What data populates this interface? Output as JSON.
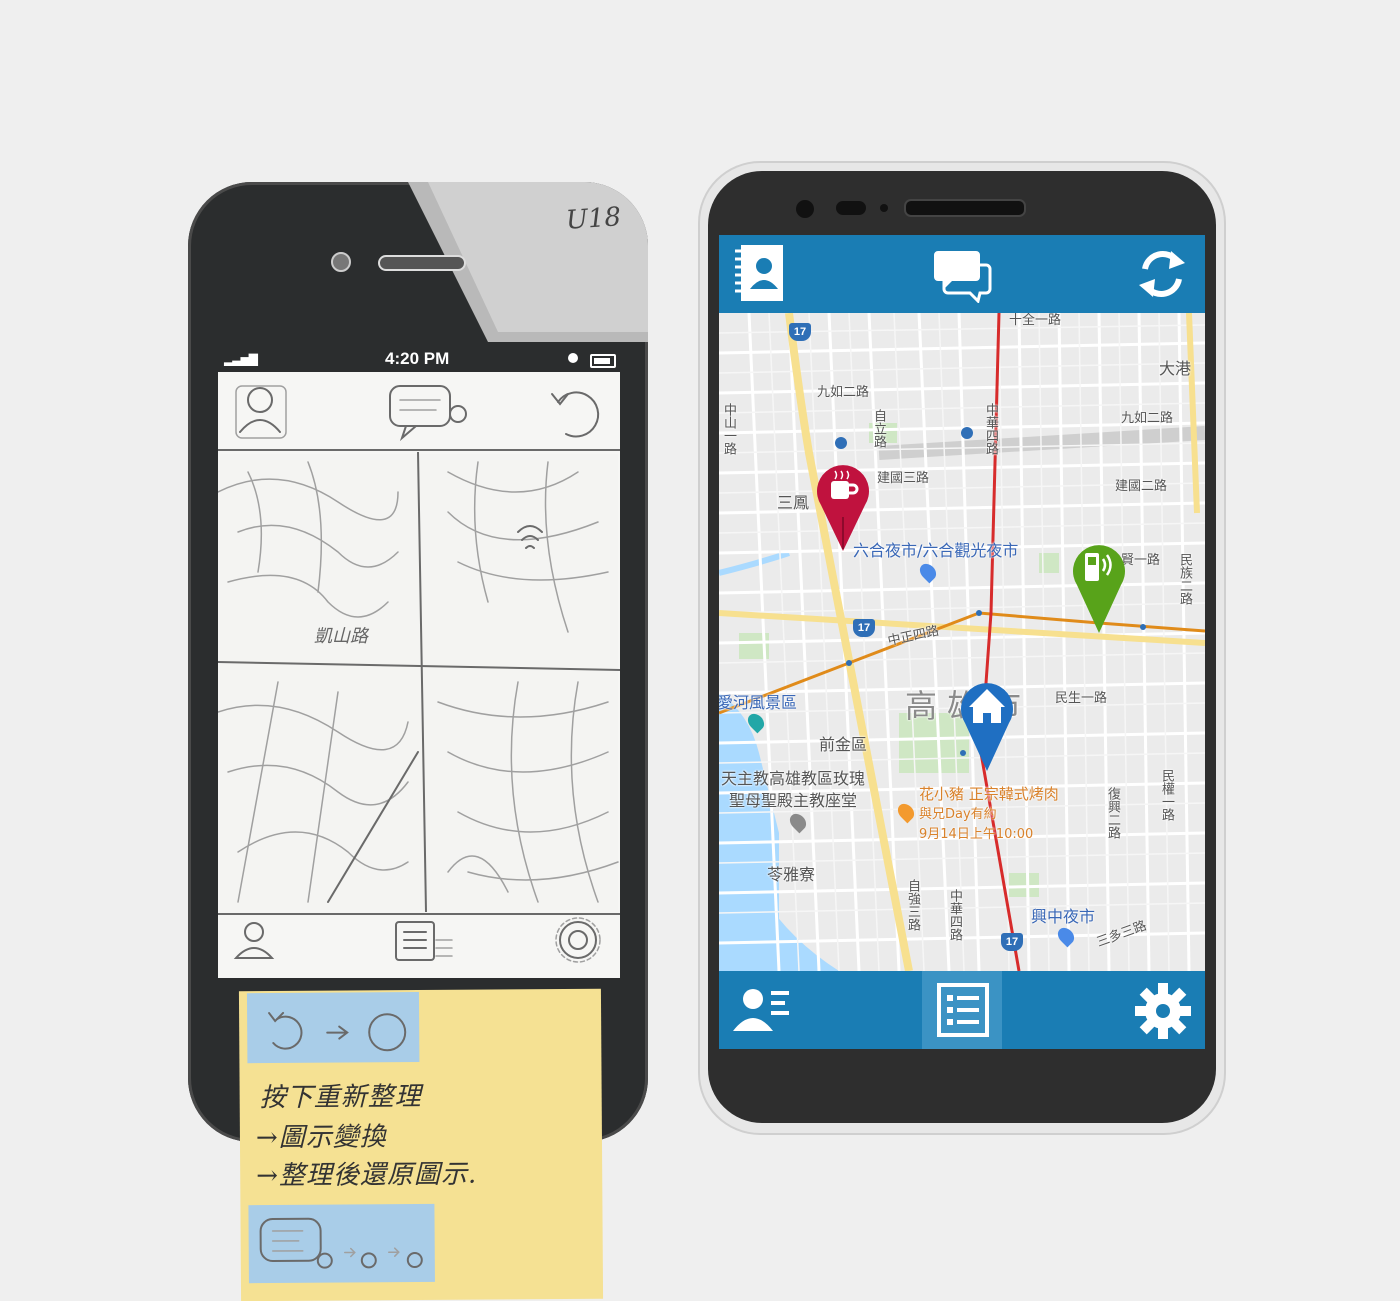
{
  "sketch": {
    "corner_mark": "U18",
    "status_time": "4:20 PM",
    "map_labels": [
      "凱山路"
    ],
    "sticky_note": {
      "lines": [
        "按下重新整理",
        "→圖示變換",
        "→整理後還原圖示."
      ]
    }
  },
  "android": {
    "top_bar": {
      "contacts_icon": "address-book-icon",
      "chat_icon": "chat-bubbles-icon",
      "refresh_icon": "refresh-icon"
    },
    "bottom_bar": {
      "profile_icon": "user-list-icon",
      "list_icon": "list-icon",
      "settings_icon": "gear-icon"
    },
    "map": {
      "city_label": "高雄市",
      "districts": [
        "前金區",
        "苓雅寮"
      ],
      "roads": [
        "九如二路",
        "九如二路",
        "建國二路",
        "建國三路",
        "三鳳",
        "民生一路",
        "中正四路",
        "自立路",
        "中華四路",
        "自強三路",
        "中華四路",
        "三多三路",
        "民族二路",
        "民權一路",
        "復興二路",
        "大港",
        "賢一路",
        "十全一路",
        "中山一路"
      ],
      "road_numbers": [
        "17",
        "17",
        "17"
      ],
      "pois": {
        "night_market_1": "六合夜市/六合觀光夜市",
        "scenic": "愛河風景區",
        "church_line1": "天主教高雄教區玫瑰",
        "church_line2": "聖母聖殿主教座堂",
        "restaurant": "花小豬 正宗韓式烤肉",
        "date_line1": "與兄Day有約",
        "date_line2": "9月14日上午10:00",
        "night_market_2": "興中夜市"
      },
      "pins": [
        {
          "name": "coffee-pin",
          "icon": "coffee-cup-icon",
          "color": "#c0123e"
        },
        {
          "name": "phone-pin",
          "icon": "mobile-phone-icon",
          "color": "#58a31a"
        },
        {
          "name": "home-pin",
          "icon": "home-icon",
          "color": "#1f6fc2"
        }
      ]
    },
    "colors": {
      "bar": "#1a7db4",
      "bar_active": "#3b93c4",
      "route_red": "#d72b2b",
      "route_orange": "#e08b1a"
    }
  }
}
